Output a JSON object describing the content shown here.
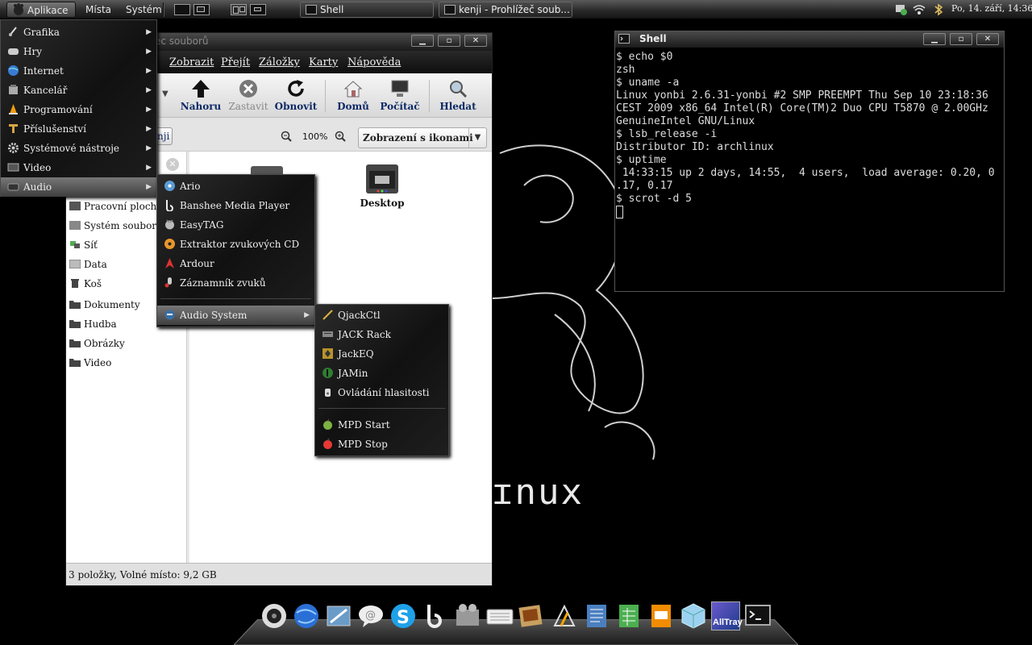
{
  "top_panel": {
    "menus": {
      "applications": "Aplikace",
      "places": "Místa",
      "system": "Systém"
    },
    "tasks": [
      {
        "label": "Shell"
      },
      {
        "label": "kenji - Prohlížeč soub..."
      }
    ],
    "clock": "Po, 14. září, 14:36"
  },
  "applications_menu": {
    "items": [
      {
        "label": "Grafika",
        "icon": "graphics-icon"
      },
      {
        "label": "Hry",
        "icon": "games-icon"
      },
      {
        "label": "Internet",
        "icon": "internet-globe-icon"
      },
      {
        "label": "Kancelář",
        "icon": "office-icon"
      },
      {
        "label": "Programování",
        "icon": "vlc-cone-icon"
      },
      {
        "label": "Příslušenství",
        "icon": "accessories-icon"
      },
      {
        "label": "Systémové nástroje",
        "icon": "gear-icon"
      },
      {
        "label": "Video",
        "icon": "film-icon"
      },
      {
        "label": "Audio",
        "icon": "audio-icon"
      }
    ]
  },
  "audio_menu": {
    "items": [
      {
        "label": "Ario"
      },
      {
        "label": "Banshee Media Player"
      },
      {
        "label": "EasyTAG"
      },
      {
        "label": "Extraktor zvukových CD"
      },
      {
        "label": "Ardour"
      },
      {
        "label": "Záznamník zvuků"
      }
    ],
    "submenu_label": "Audio System"
  },
  "audio_system_menu": {
    "items": [
      {
        "label": "QjackCtl"
      },
      {
        "label": "JACK Rack"
      },
      {
        "label": "JackEQ"
      },
      {
        "label": "JAMin"
      },
      {
        "label": "Ovládání hlasitosti"
      }
    ],
    "items2": [
      {
        "label": "MPD Start"
      },
      {
        "label": "MPD Stop"
      }
    ]
  },
  "file_manager": {
    "title": "ec souborů",
    "menubar": [
      "Zobrazit",
      "Přejít",
      "Záložky",
      "Karty",
      "Nápověda"
    ],
    "toolbar": {
      "up": "Nahoru",
      "stop": "Zastavit",
      "reload": "Obnovit",
      "home": "Domů",
      "computer": "Počítač",
      "search": "Hledat"
    },
    "location_button": "nji",
    "zoom": "100%",
    "view_mode": "Zobrazení s ikonami",
    "sidebar": [
      {
        "label": "Pracovní plocha"
      },
      {
        "label": "Systém souborů"
      },
      {
        "label": "Síť"
      },
      {
        "label": "Data"
      },
      {
        "label": "Koš"
      },
      {
        "label": "Dokumenty"
      },
      {
        "label": "Hudba"
      },
      {
        "label": "Obrázky"
      },
      {
        "label": "Video"
      }
    ],
    "files": [
      {
        "label": "Desktop"
      }
    ],
    "status": "3 položky, Volné místo: 9,2 GB"
  },
  "terminal": {
    "title": "Shell",
    "lines": [
      "$ echo $0",
      "zsh",
      "$ uname -a",
      "Linux yonbi 2.6.31-yonbi #2 SMP PREEMPT Thu Sep 10 23:18:36",
      "CEST 2009 x86_64 Intel(R) Core(TM)2 Duo CPU T5870 @ 2.00GHz",
      "GenuineIntel GNU/Linux",
      "$ lsb_release -i",
      "Distributor ID: archlinux",
      "$ uptime",
      " 14:33:15 up 2 days, 14:55,  4 users,  load average: 0.20, 0",
      ".17, 0.17",
      "$ scrot -d 5"
    ]
  },
  "wallpaper": {
    "text": "ɪnux"
  },
  "dock": {
    "apps": [
      {
        "icon": "disk-utility-icon"
      },
      {
        "icon": "browser-globe-icon"
      },
      {
        "icon": "mail-icon"
      },
      {
        "icon": "chat-bubble-icon"
      },
      {
        "icon": "skype-icon"
      },
      {
        "icon": "banshee-icon"
      },
      {
        "icon": "video-editor-icon"
      },
      {
        "icon": "keyboard-icon"
      },
      {
        "icon": "photo-icon"
      },
      {
        "icon": "vector-drawing-icon"
      },
      {
        "icon": "writer-icon"
      },
      {
        "icon": "spreadsheet-icon"
      },
      {
        "icon": "presentation-icon"
      },
      {
        "icon": "package-cube-icon"
      },
      {
        "icon": "alltray-icon",
        "label": "AllTray"
      },
      {
        "icon": "terminal-icon"
      }
    ]
  },
  "colors": {
    "menu_highlight": "#5c5c5c",
    "toolbar_label": "#0d2a66",
    "panel": "#2a2a2a"
  }
}
